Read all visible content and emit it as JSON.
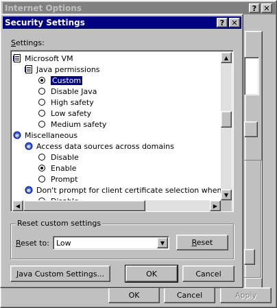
{
  "background_window": {
    "title": "Internet Options",
    "buttons": {
      "ok": "OK",
      "cancel": "Cancel",
      "apply": "Apply"
    }
  },
  "dialog": {
    "title": "Security Settings",
    "settings_label": "Settings:",
    "tree": [
      {
        "label": "Microsoft VM",
        "kind": "folder",
        "icon": "page-icon"
      },
      {
        "label": "Java permissions",
        "kind": "folder",
        "icon": "page-icon"
      },
      {
        "label": "Custom",
        "kind": "radio",
        "checked": true,
        "selected": true
      },
      {
        "label": "Disable Java",
        "kind": "radio",
        "checked": false
      },
      {
        "label": "High safety",
        "kind": "radio",
        "checked": false
      },
      {
        "label": "Low safety",
        "kind": "radio",
        "checked": false
      },
      {
        "label": "Medium safety",
        "kind": "radio",
        "checked": false
      },
      {
        "label": "Miscellaneous",
        "kind": "folder",
        "icon": "ie-icon"
      },
      {
        "label": "Access data sources across domains",
        "kind": "folder",
        "icon": "ie-icon"
      },
      {
        "label": "Disable",
        "kind": "radio",
        "checked": false
      },
      {
        "label": "Enable",
        "kind": "radio",
        "checked": true
      },
      {
        "label": "Prompt",
        "kind": "radio",
        "checked": false
      },
      {
        "label": "Don't prompt for client certificate selection when no certi",
        "kind": "folder",
        "icon": "ie-icon"
      },
      {
        "label": "Disable",
        "kind": "radio",
        "checked": false
      }
    ],
    "reset_group": {
      "label": "Reset custom settings",
      "reset_to_label": "Reset to:",
      "selected": "Low",
      "reset_button": "Reset"
    },
    "buttons": {
      "java_custom": "Java Custom Settings...",
      "ok": "OK",
      "cancel": "Cancel"
    }
  },
  "colors": {
    "title_active": "#000080",
    "title_inactive": "#808080",
    "face": "#c0c0c0"
  }
}
